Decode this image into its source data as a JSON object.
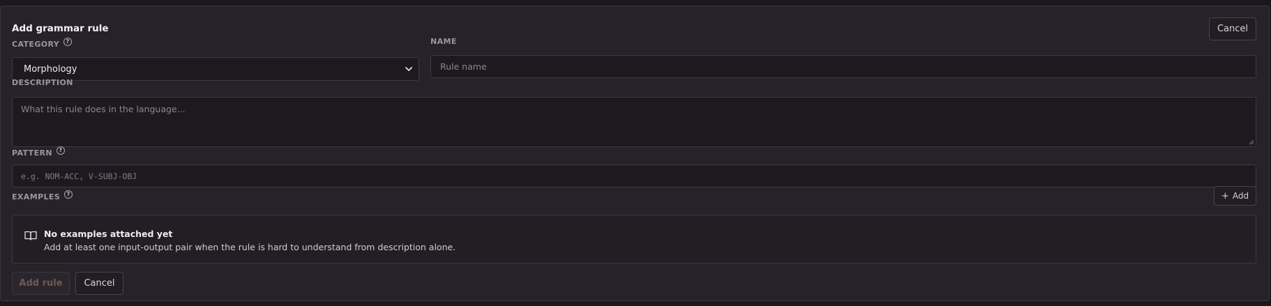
{
  "form": {
    "title": "Add grammar rule",
    "top_cancel_label": "Cancel",
    "category": {
      "label": "CATEGORY",
      "value": "Morphology"
    },
    "name": {
      "label": "NAME",
      "placeholder": "Rule name"
    },
    "description": {
      "label": "DESCRIPTION",
      "placeholder": "What this rule does in the language..."
    },
    "pattern": {
      "label": "PATTERN",
      "placeholder": "e.g. NOM-ACC, V-SUBJ-OBJ"
    },
    "examples": {
      "label": "EXAMPLES",
      "add_label": "Add",
      "empty_title": "No examples attached yet",
      "empty_text": "Add at least one input-output pair when the rule is hard to understand from description alone."
    },
    "actions": {
      "submit_label": "Add rule",
      "cancel_label": "Cancel"
    }
  },
  "icons": {
    "help": "help-circle-icon",
    "chevron": "chevron-down-icon",
    "book": "open-book-icon",
    "plus": "plus-icon"
  },
  "colors": {
    "background": "#1a181c",
    "panel": "#252329",
    "field": "#1c1a1f",
    "border": "#3d3a41",
    "disabled_text": "#6e5a55"
  }
}
